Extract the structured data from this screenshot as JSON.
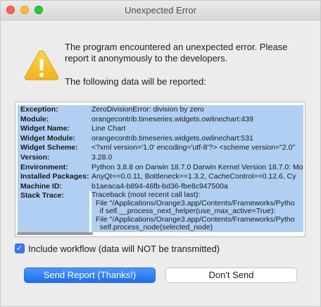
{
  "window": {
    "title": "Unexpected Error"
  },
  "message": {
    "text": "The program encountered an unexpected error. Please report it anonymously to the developers.",
    "data_intro": "The following data will be reported:"
  },
  "report": {
    "rows": [
      {
        "key": "Exception:",
        "value": "ZeroDivisionError: division by zero"
      },
      {
        "key": "Module:",
        "value": "orangecontrib.timeseries.widgets.owlinechart:439"
      },
      {
        "key": "Widget Name:",
        "value": "Line Chart"
      },
      {
        "key": "Widget Module:",
        "value": "orangecontrib.timeseries.widgets.owlinechart:531"
      },
      {
        "key": "Widget Scheme:",
        "value": "<?xml version='1.0' encoding='utf-8'?> <scheme version=\"2.0\""
      },
      {
        "key": "Version:",
        "value": "3.28.0"
      },
      {
        "key": "Environment:",
        "value": "Python 3.8.8 on Darwin 18.7.0 Darwin Kernel Version 18.7.0: Mo"
      },
      {
        "key": "Installed Packages:",
        "value": "AnyQt==0.0.11, Bottleneck==1.3.2, CacheControl==0.12.6, Cy"
      },
      {
        "key": "Machine ID:",
        "value": "b1aeaca4-b894-46fb-bd36-fbe8c947500a"
      }
    ],
    "stack_trace": {
      "key": "Stack Trace:",
      "lines": [
        "Traceback (most recent call last):",
        "  File \"/Applications/Orange3.app/Contents/Frameworks/Pytho",
        "    if self.__process_next_helper(use_max_active=True):",
        "  File \"/Applications/Orange3.app/Contents/Frameworks/Pytho",
        "    self.process_node(selected_node)"
      ]
    }
  },
  "options": {
    "include_workflow_label": "Include workflow (data will NOT be transmitted)",
    "include_workflow_checked": true
  },
  "buttons": {
    "send": "Send Report (Thanks!)",
    "dont_send": "Don't Send"
  },
  "icons": {
    "warning": "warning-triangle-icon"
  },
  "colors": {
    "selection": "#b1cff2",
    "accent": "#3478f6",
    "warning_yellow": "#f5c12c"
  }
}
